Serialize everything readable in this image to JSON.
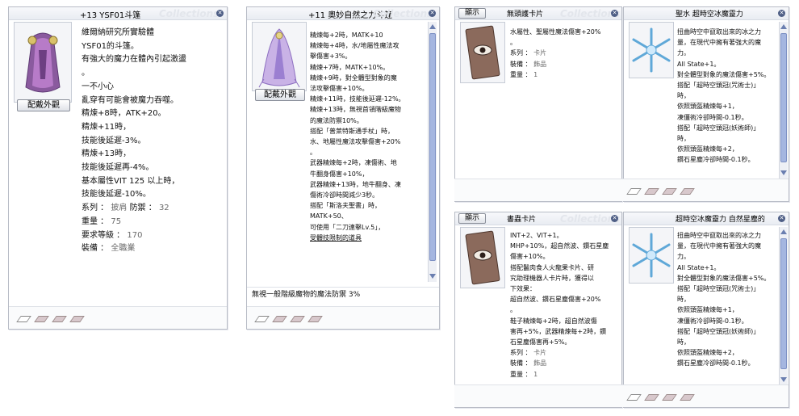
{
  "watermark": "Collections",
  "close_glyph": "✕",
  "colors": {
    "scroll_thumb": "#a5b6e0",
    "card_bg": "#8b6a5c",
    "title_bar": "#eceff4"
  },
  "panel1": {
    "title": "+13 YSF01斗篷",
    "button_label": "配戴外觀",
    "image_icon": "purple-cape-icon",
    "lines": [
      "維爾納研究所實驗體",
      "YSF01的斗篷。",
      "有強大的魔力在體內引起激盪",
      "。",
      "一不小心",
      "亂穿有可能會被魔力吞噬。",
      "精煉+8時，ATK+20。",
      "精煉+11時，",
      "技能後延遲-3%。",
      "精煉+13時，",
      "技能後延遲再-4%。",
      "基本屬性VIT 125 以上時，",
      "技能後延遲-10%。"
    ],
    "kv": [
      {
        "key": "系列 ：",
        "value": "披肩",
        "key2": "防禦 ：",
        "value2": "32"
      },
      {
        "key": "重量 ：",
        "value": "75"
      },
      {
        "key": "要求等級 ：",
        "value": "170"
      },
      {
        "key": "裝備 ：",
        "value": "全職業"
      }
    ]
  },
  "panel2": {
    "title": "+11 奧妙自然之力斗篷",
    "button_label": "配戴外觀",
    "image_icon": "nature-cape-icon",
    "lines": [
      "精煉每+2時，MATK+10",
      "精煉每+4時，水/地屬性魔法攻",
      "擊傷害+3%。",
      "精煉+7時，MATK+10%。",
      "精煉+9時，對全體型對象的魔",
      "法攻擊傷害+10%。",
      "精煉+11時，技能後延遲-12%。",
      "精煉+13時，無視首領階級魔物",
      "的魔法防禦10%。",
      "搭配「普萊特斯通手杖」時，",
      "水、地屬性魔法攻擊傷害+20%",
      "。",
      "武器精煉每+2時，凍傷術、地",
      "牛翻身傷害+10%，",
      "武器精煉+13時，地牛翻身、凍",
      "傷術冷卻時間減少3秒。",
      "搭配「斯洛夫聖書」時，",
      "MATK+50、",
      "可使用「二刀連擊Lv.5」，"
    ],
    "underline_line": "受體技限制的道具",
    "sub_text": "無視一般階級魔物的魔法防禦 3%"
  },
  "panel3": {
    "button_label": "顯示",
    "title": "無頭護卡片",
    "image_icon": "eye-card-icon",
    "lines": [
      "水屬性、聖屬性魔法傷害+20%",
      "。"
    ],
    "kv": [
      {
        "key": "系列 ：",
        "value": "卡片"
      },
      {
        "key": "裝備 ：",
        "value": "飾品"
      },
      {
        "key": "重量 ：",
        "value": "1"
      }
    ]
  },
  "panel4": {
    "title": "聖水 超時空冰魔靈力",
    "image_icon": "ice-crystal-icon",
    "lines": [
      "扭曲時空中竄取出來的冰之力",
      "量，在現代中擁有著強大的魔",
      "力。",
      "All State+1。",
      "對全體型對象的魔法傷害+5%。",
      "搭配「超時空頭冠(咒術士)」",
      "時，",
      "依照頭盔精煉每+1，",
      "凍僵術冷卻時間-0.1秒。",
      "搭配「超時空頭冠(妖術師)」",
      "時，",
      "依照頭盔精煉每+2，",
      "鑽石星塵冷卻時間-0.1秒。"
    ]
  },
  "panel5": {
    "button_label": "顯示",
    "title": "書蟲卡片",
    "image_icon": "eye-card-icon",
    "lines": [
      "INT+2、VIT+1。",
      "MHP+10%，超自然波、鑽石星塵",
      "傷害+10%。",
      "搭配鬣肉食人火龍果卡片、研",
      "究助理機器人卡片時，獲得以",
      "下效果：",
      "超自然波、鑽石星塵傷害+20%",
      "。",
      "鞋子精煉每+2時，超自然波傷",
      "害再+5%，武器精煉每+2時，鑽",
      "石星塵傷害再+5%。"
    ],
    "kv": [
      {
        "key": "系列 ：",
        "value": "卡片"
      },
      {
        "key": "裝備 ：",
        "value": "飾品"
      },
      {
        "key": "重量 ：",
        "value": "1"
      }
    ]
  },
  "panel6": {
    "title": "超時空冰魔靈力 自然星塵的",
    "image_icon": "ice-crystal-icon",
    "lines": [
      "扭曲時空中竄取出來的冰之力",
      "量，在現代中擁有著強大的魔",
      "力。",
      "All State+1。",
      "對全體型對象的魔法傷害+5%。",
      "搭配「超時空頭冠(咒術士)」",
      "時，",
      "依照頭盔精煉每+1，",
      "凍僵術冷卻時間-0.1秒。",
      "搭配「超時空頭冠(妖術師)」",
      "時，",
      "依照頭盔精煉每+2，",
      "鑽石星塵冷卻時間-0.1秒。"
    ]
  }
}
